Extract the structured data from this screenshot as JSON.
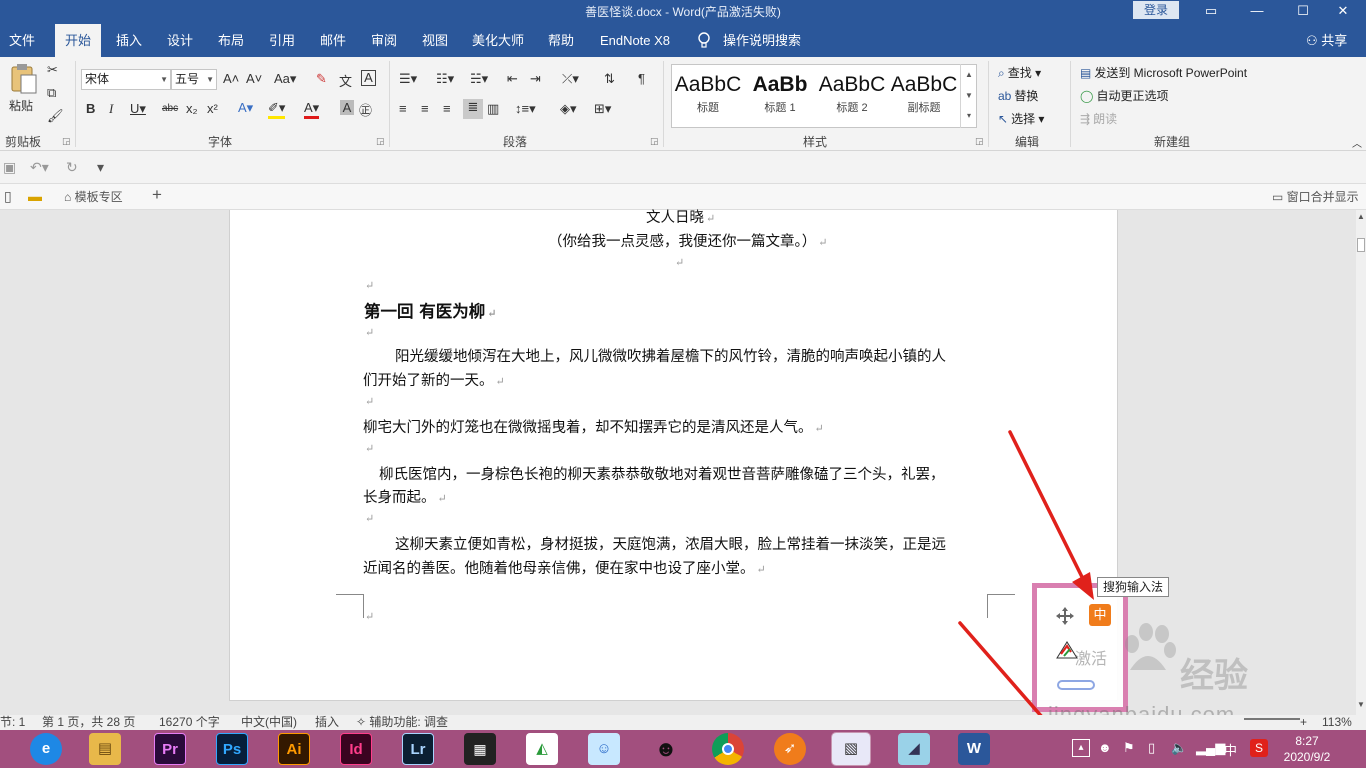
{
  "window": {
    "title": "善医怪谈.docx  -  Word(产品激活失败)",
    "login_label": "登录",
    "restore_icon": "ribbon-display-icon",
    "min_icon": "minimize-icon",
    "max_icon": "maximize-icon",
    "close_icon": "close-icon"
  },
  "menu": {
    "tabs": [
      "文件",
      "开始",
      "插入",
      "设计",
      "布局",
      "引用",
      "邮件",
      "审阅",
      "视图",
      "美化大师",
      "帮助",
      "EndNote X8"
    ],
    "active_tab": "开始",
    "tell_me": "操作说明搜索",
    "share": "共享"
  },
  "ribbon": {
    "clipboard": {
      "paste_label": "粘贴",
      "group_label": "剪贴板"
    },
    "font": {
      "font_name": "宋体",
      "font_size": "五号",
      "group_label": "字体"
    },
    "paragraph": {
      "group_label": "段落"
    },
    "styles": {
      "group_label": "样式",
      "items": [
        {
          "preview": "AaBbC",
          "name": "标题"
        },
        {
          "preview": "AaBb",
          "name": "标题 1"
        },
        {
          "preview": "AaBbC",
          "name": "标题 2"
        },
        {
          "preview": "AaBbC",
          "name": "副标题"
        }
      ]
    },
    "editing": {
      "find": "查找",
      "replace": "替换",
      "select": "选择",
      "group_label": "编辑"
    },
    "newgroup": {
      "send_ppt": "发送到 Microsoft PowerPoint",
      "autocorrect": "自动更正选项",
      "read_aloud": "朗读",
      "group_label": "新建组"
    }
  },
  "tabbar": {
    "template_zone": "模板专区",
    "merge_windows": "窗口合并显示"
  },
  "document": {
    "author": "文人日晓",
    "subtitle": "（你给我一点灵感，我便还你一篇文章。）",
    "chapter_title": "第一回  有医为柳",
    "para1_line1": "阳光缓缓地倾泻在大地上，风儿微微吹拂着屋檐下的风竹铃，清脆的响声唤起小镇的人",
    "para1_line2": "们开始了新的一天。",
    "para2": "柳宅大门外的灯笼也在微微摇曳着，却不知摆弄它的是清风还是人气。",
    "para3_line1": "柳氏医馆内，一身棕色长袍的柳天素恭恭敬敬地对着观世音菩萨雕像磕了三个头，礼罢，",
    "para3_line2": "长身而起。",
    "para4_line1": "这柳天素立便如青松，身材挺拔，天庭饱满，浓眉大眼，脸上常挂着一抹淡笑，正是远",
    "para4_line2": "近闻名的善医。他随着他母亲信佛，便在家中也设了座小堂。",
    "paragraph_mark": "↵"
  },
  "ime": {
    "tooltip": "搜狗输入法",
    "mode_label": "中",
    "faded_text": "激活"
  },
  "statusbar": {
    "section": "节: 1",
    "page": "第 1 页，共 28 页",
    "words": "16270 个字",
    "language": "中文(中国)",
    "insert_mode": "插入",
    "accessibility": "辅助功能: 调查",
    "zoom": "113%"
  },
  "taskbar": {
    "apps": [
      "360-browser-icon",
      "file-explorer-icon",
      "premiere-icon",
      "photoshop-icon",
      "illustrator-icon",
      "indesign-icon",
      "lightroom-icon",
      "video-editor-icon",
      "paint-app-icon",
      "cartoon-app-icon",
      "qq-icon",
      "chrome-icon",
      "orange-app-icon",
      "installer-icon",
      "blue-app-icon",
      "word-icon"
    ],
    "app_labels": {
      "pr": "Pr",
      "ps": "Ps",
      "ai": "Ai",
      "id": "Id",
      "lr": "Lr",
      "word": "W"
    },
    "tray_ime": "中",
    "time": "8:27",
    "date": "2020/9/2"
  },
  "watermark": {
    "url": "jingyanbaidu.com",
    "brand": "经验"
  },
  "colors": {
    "word_blue": "#2b579a",
    "taskbar": "#a24f7e",
    "ime_border": "#d97fb0",
    "arrow_red": "#e0211b"
  }
}
